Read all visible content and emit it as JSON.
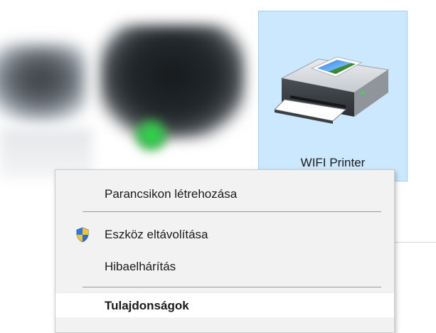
{
  "tile": {
    "label": "WIFI Printer",
    "selected": true
  },
  "context_menu": {
    "items": [
      {
        "label": "Parancsikon létrehozása"
      },
      {
        "label": "Eszköz eltávolítása",
        "icon": "uac-shield-icon"
      },
      {
        "label": "Hibaelhárítás"
      },
      {
        "label": "Tulajdonságok",
        "bold": true
      }
    ]
  },
  "colors": {
    "tile_selected_bg": "#cce8ff",
    "tile_selected_border": "#99d1ff",
    "menu_bg": "#f2f2f2",
    "separator": "#9a9a9a"
  }
}
